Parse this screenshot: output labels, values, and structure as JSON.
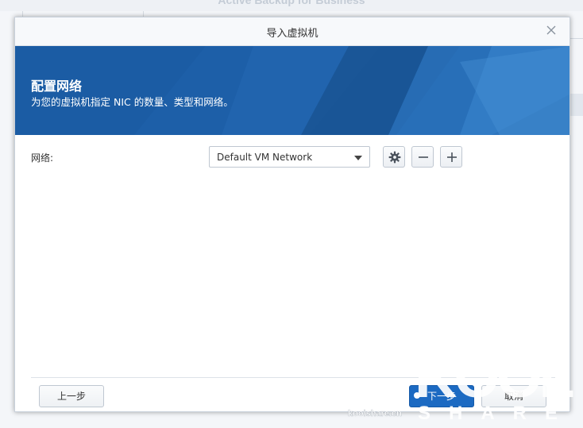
{
  "background": {
    "app_title": "Active Backup for Business"
  },
  "dialog": {
    "title": "导入虚拟机",
    "close_icon": "close-icon"
  },
  "banner": {
    "heading": "配置网络",
    "description": "为您的虚拟机指定 NIC 的数量、类型和网络。"
  },
  "network": {
    "label": "网络:",
    "selected": "Default VM Network",
    "icons": [
      "gear-icon",
      "minus-icon",
      "plus-icon"
    ]
  },
  "footer": {
    "back_label": "上一步",
    "next_label": "下一步",
    "cancel_label": "取消"
  },
  "watermark": {
    "brand": "KOOL",
    "sub": "SHARE",
    "site": "koolshare.cn"
  },
  "colors": {
    "banner": "#1d5fa8",
    "primary": "#1c6ac2"
  }
}
